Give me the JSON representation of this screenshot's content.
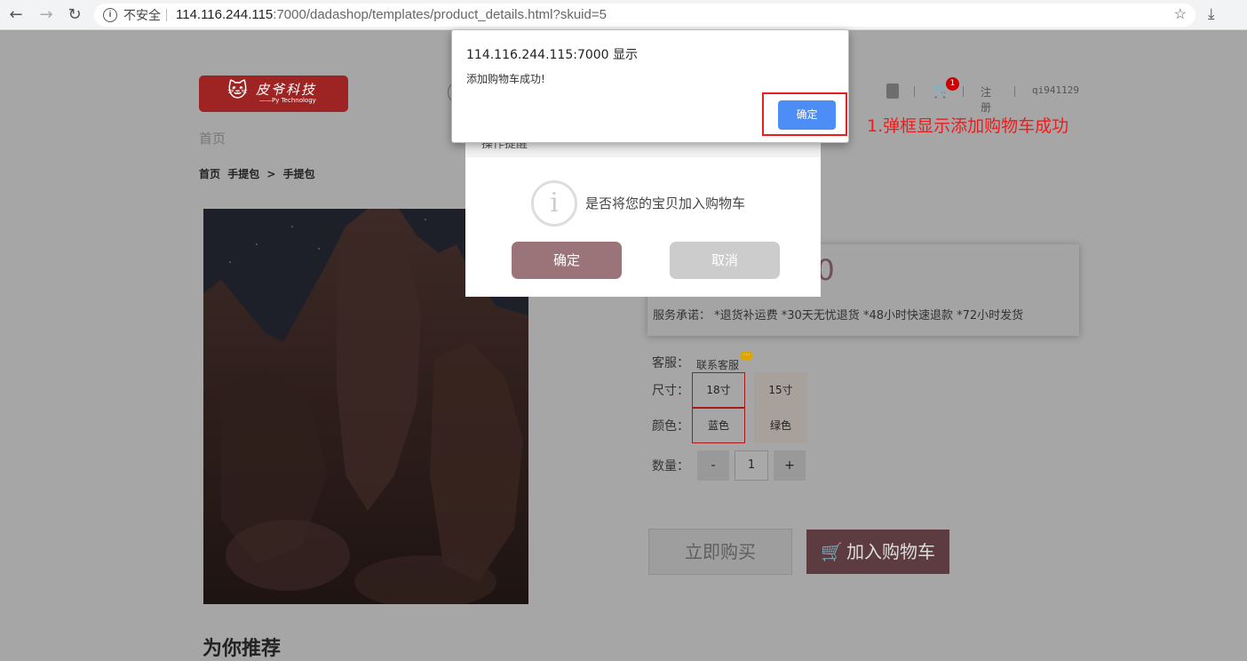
{
  "browser": {
    "back_icon": "←",
    "forward_icon": "→",
    "reload_icon": "↻",
    "insecure_label": "不安全",
    "url_host": "114.116.244.115",
    "url_rest": ":7000/dadashop/templates/product_details.html?skuid=5",
    "star_icon": "☆",
    "download_icon": "⤓"
  },
  "header": {
    "logo_title": "皮爷科技",
    "logo_sub": "——Py Technology",
    "home_link": "首页",
    "cart_count": "1",
    "register": "注册",
    "username": "qi941129"
  },
  "breadcrumb": [
    "首页",
    "手提包",
    ">",
    "手提包"
  ],
  "product": {
    "price_visible": "00",
    "promise": "服务承诺：  *退货补运费  *30天无忧退货  *48小时快速退款  *72小时发货",
    "cs_label": "客服：",
    "cs_link": "联系客服",
    "size_label": "尺寸：",
    "sizes": [
      "18寸",
      "15寸"
    ],
    "selected_size": "18寸",
    "color_label": "颜色：",
    "colors": [
      "蓝色",
      "绿色"
    ],
    "selected_color": "蓝色",
    "qty_label": "数量：",
    "qty_minus": "-",
    "qty_value": "1",
    "qty_plus": "+",
    "buy_now": "立即购买",
    "add_cart": "加入购物车",
    "hot_title": "为你推荐"
  },
  "dialog": {
    "title": "操作提醒",
    "message": "是否将您的宝贝加入购物车",
    "confirm": "确定",
    "cancel": "取消"
  },
  "alert": {
    "origin": "114.116.244.115:7000 显示",
    "message": "添加购物车成功!",
    "ok": "确定"
  },
  "annotation": {
    "text": "1.弹框显示添加购物车成功",
    "color": "#ee1c1c"
  }
}
